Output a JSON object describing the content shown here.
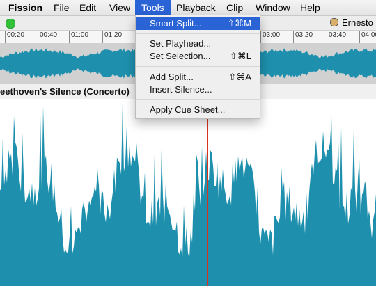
{
  "menubar": {
    "app": "Fission",
    "items": [
      "File",
      "Edit",
      "View",
      "Tools",
      "Playback",
      "Clip",
      "Window",
      "Help"
    ]
  },
  "toolbar": {
    "user_name": "Ernesto"
  },
  "ruler": {
    "labels": [
      "00:20",
      "00:40",
      "01:00",
      "01:20",
      "03:00",
      "03:20",
      "03:40",
      "04:00"
    ]
  },
  "track": {
    "title": "eethoven's Silence (Concerto)"
  },
  "tools_menu": {
    "smart_split": {
      "label": "Smart Split...",
      "shortcut": "⇧⌘M"
    },
    "set_playhead": {
      "label": "Set Playhead..."
    },
    "set_selection": {
      "label": "Set Selection...",
      "shortcut": "⇧⌘L"
    },
    "add_split": {
      "label": "Add Split...",
      "shortcut": "⇧⌘A"
    },
    "insert_silence": {
      "label": "Insert Silence..."
    },
    "apply_cue_sheet": {
      "label": "Apply Cue Sheet..."
    }
  },
  "colors": {
    "waveform": "#1e90ad",
    "playhead": "#d8331f",
    "menu_highlight": "#2a63d6"
  }
}
